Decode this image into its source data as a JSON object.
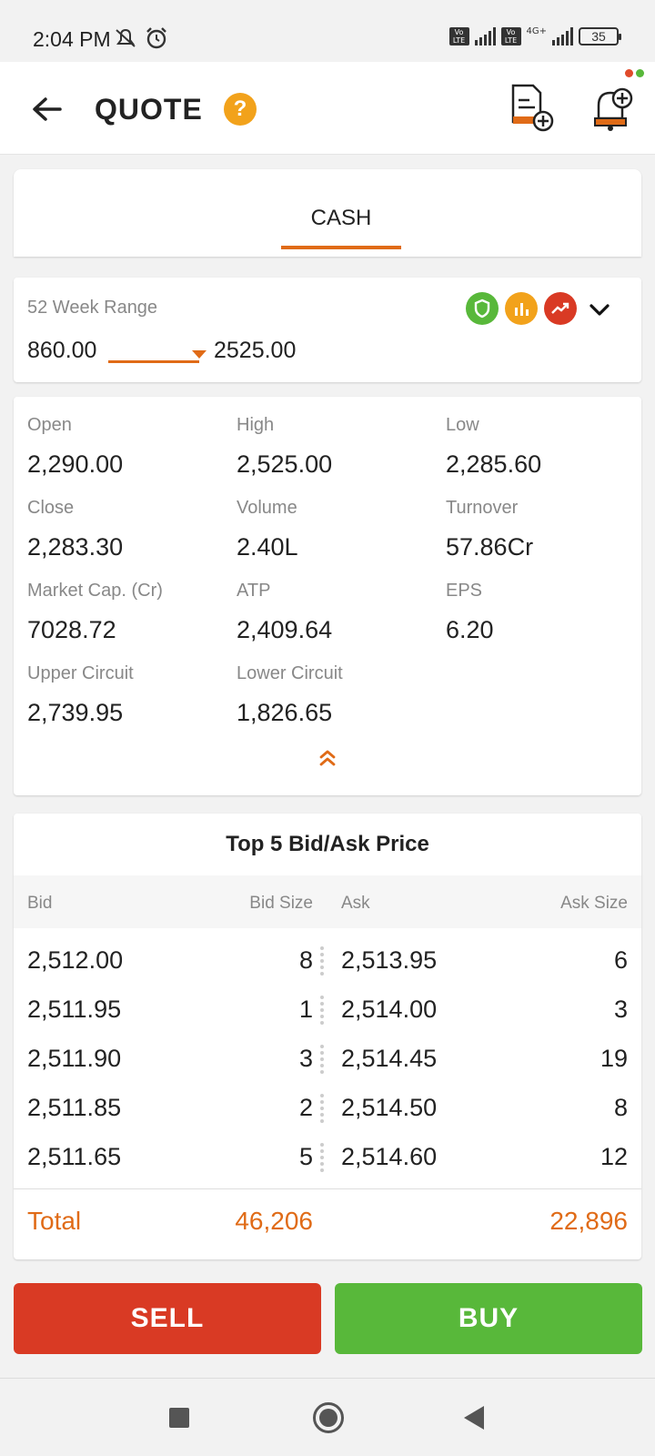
{
  "status_bar": {
    "time": "2:04 PM",
    "network": "4G+",
    "battery": "35"
  },
  "header": {
    "title": "QUOTE",
    "help_glyph": "?"
  },
  "tabs": [
    {
      "label": "CASH",
      "active": true
    }
  ],
  "range": {
    "title": "52 Week Range",
    "low": "860.00",
    "high": "2525.00"
  },
  "stats": [
    {
      "label": "Open",
      "value": "2,290.00"
    },
    {
      "label": "High",
      "value": "2,525.00"
    },
    {
      "label": "Low",
      "value": "2,285.60"
    },
    {
      "label": "Close",
      "value": "2,283.30"
    },
    {
      "label": "Volume",
      "value": "2.40L"
    },
    {
      "label": "Turnover",
      "value": "57.86Cr"
    },
    {
      "label": "Market Cap. (Cr)",
      "value": "7028.72"
    },
    {
      "label": "ATP",
      "value": "2,409.64"
    },
    {
      "label": "EPS",
      "value": "6.20"
    },
    {
      "label": "Upper Circuit",
      "value": "2,739.95"
    },
    {
      "label": "Lower Circuit",
      "value": "1,826.65"
    }
  ],
  "order_book": {
    "title": "Top 5 Bid/Ask Price",
    "headers": {
      "bid": "Bid",
      "bid_size": "Bid Size",
      "ask": "Ask",
      "ask_size": "Ask Size"
    },
    "rows": [
      {
        "bid": "2,512.00",
        "bid_size": "8",
        "ask": "2,513.95",
        "ask_size": "6"
      },
      {
        "bid": "2,511.95",
        "bid_size": "1",
        "ask": "2,514.00",
        "ask_size": "3"
      },
      {
        "bid": "2,511.90",
        "bid_size": "3",
        "ask": "2,514.45",
        "ask_size": "19"
      },
      {
        "bid": "2,511.85",
        "bid_size": "2",
        "ask": "2,514.50",
        "ask_size": "8"
      },
      {
        "bid": "2,511.65",
        "bid_size": "5",
        "ask": "2,514.60",
        "ask_size": "12"
      }
    ],
    "total": {
      "label": "Total",
      "bid_size": "46,206",
      "ask_size": "22,896"
    }
  },
  "actions": {
    "sell": "SELL",
    "buy": "BUY"
  },
  "icons": {
    "back": "arrow-left-icon",
    "help": "help-icon",
    "order": "add-order-icon",
    "alert": "add-alert-bell-icon",
    "indicators": [
      "shield-icon",
      "bar-chart-icon",
      "trend-up-icon"
    ],
    "expand": "chevron-down-icon",
    "collapse": "double-chevron-up-icon"
  },
  "colors": {
    "accent": "#e06b17",
    "sell": "#d93a24",
    "buy": "#58b83a",
    "help": "#f2a21b",
    "shield": "#58b83a",
    "chart": "#f2a21b",
    "trend": "#d93a24"
  }
}
